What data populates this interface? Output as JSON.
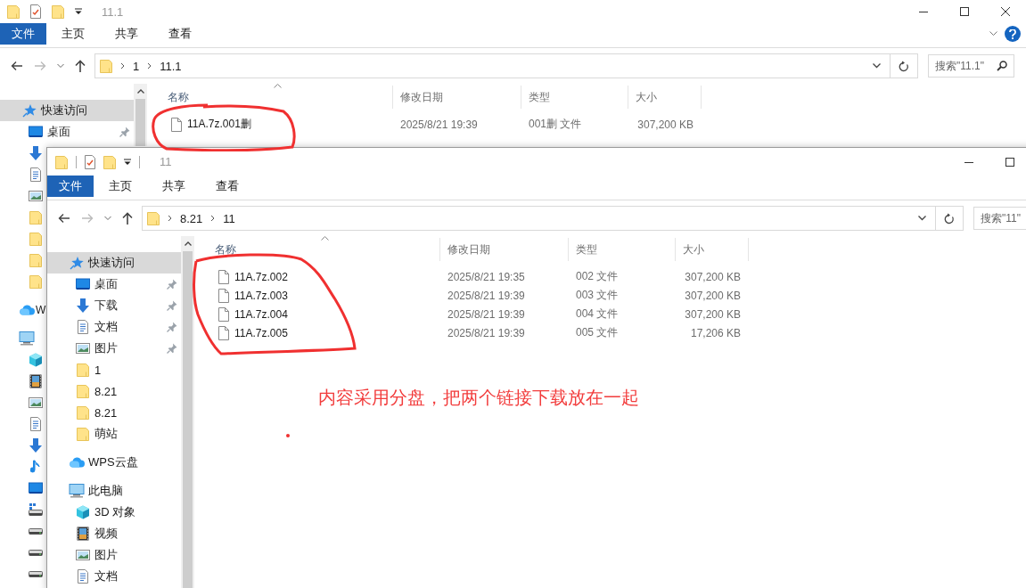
{
  "windows": [
    {
      "title": "11.1",
      "help_button": true,
      "ribbon_tabs": [
        {
          "label": "文件",
          "kind": "menu"
        },
        {
          "label": "主页",
          "kind": "tab"
        },
        {
          "label": "共享",
          "kind": "tab"
        },
        {
          "label": "查看",
          "kind": "tab"
        }
      ],
      "address": [
        "1",
        "11.1"
      ],
      "search": {
        "placeholder": "搜索\"11.1\""
      },
      "nav": [
        {
          "kind": "star",
          "label": "快速访问",
          "selected": true,
          "children": [
            {
              "kind": "desktop",
              "label": "桌面",
              "selected": false,
              "pinned": true
            },
            {
              "kind": "download",
              "selected": false
            },
            {
              "kind": "doc",
              "selected": false
            },
            {
              "kind": "picture",
              "selected": false
            },
            {
              "kind": "folder",
              "selected": false
            },
            {
              "kind": "folder",
              "selected": false
            },
            {
              "kind": "folder",
              "selected": false
            },
            {
              "kind": "folder",
              "selected": false
            }
          ]
        },
        {
          "kind": "cloud",
          "label": "W",
          "selected": false
        },
        {
          "kind": "pc",
          "selected": false,
          "children": [
            {
              "kind": "cube",
              "selected": false
            },
            {
              "kind": "video",
              "selected": false
            },
            {
              "kind": "picture",
              "selected": false
            },
            {
              "kind": "doc",
              "selected": false
            },
            {
              "kind": "download",
              "selected": false
            },
            {
              "kind": "music",
              "selected": false
            },
            {
              "kind": "desktop",
              "selected": false
            },
            {
              "kind": "netdrive",
              "selected": false
            },
            {
              "kind": "drive",
              "selected": false
            },
            {
              "kind": "drive",
              "selected": false
            },
            {
              "kind": "drive",
              "selected": false
            }
          ]
        }
      ],
      "columns": [
        "名称",
        "修改日期",
        "类型",
        "大小"
      ],
      "rows": [
        {
          "name": "11A.7z.001删",
          "modified": "2025/8/21 19:39",
          "type": "001删 文件",
          "size": "307,200 KB"
        }
      ]
    },
    {
      "title": "11",
      "ribbon_tabs": [
        {
          "label": "文件",
          "kind": "menu"
        },
        {
          "label": "主页",
          "kind": "tab"
        },
        {
          "label": "共享",
          "kind": "tab"
        },
        {
          "label": "查看",
          "kind": "tab"
        }
      ],
      "address": [
        "8.21",
        "11"
      ],
      "search": {
        "placeholder": "搜索\"11\""
      },
      "nav": [
        {
          "kind": "star",
          "label": "快速访问",
          "selected": true,
          "children": [
            {
              "kind": "desktop",
              "label": "桌面",
              "selected": false,
              "pinned": true
            },
            {
              "kind": "download",
              "label": "下载",
              "selected": false,
              "pinned": true
            },
            {
              "kind": "doc",
              "label": "文档",
              "selected": false,
              "pinned": true
            },
            {
              "kind": "picture",
              "label": "图片",
              "selected": false,
              "pinned": true
            },
            {
              "kind": "folder",
              "label": "1",
              "selected": false,
              "pinned": false
            },
            {
              "kind": "folder",
              "label": "8.21",
              "selected": false,
              "pinned": false
            },
            {
              "kind": "folder",
              "label": "8.21",
              "selected": false,
              "pinned": false
            },
            {
              "kind": "folder",
              "label": "萌站",
              "selected": false,
              "pinned": false
            }
          ]
        },
        {
          "kind": "cloud",
          "label": "WPS云盘",
          "selected": false
        },
        {
          "kind": "pc",
          "label": "此电脑",
          "selected": false,
          "children": [
            {
              "kind": "cube",
              "label": "3D 对象",
              "selected": false
            },
            {
              "kind": "video",
              "label": "视频",
              "selected": false
            },
            {
              "kind": "picture",
              "label": "图片",
              "selected": false
            },
            {
              "kind": "doc",
              "label": "文档",
              "selected": false
            }
          ]
        }
      ],
      "columns": [
        "名称",
        "修改日期",
        "类型",
        "大小"
      ],
      "rows": [
        {
          "name": "11A.7z.002",
          "modified": "2025/8/21 19:35",
          "type": "002 文件",
          "size": "307,200 KB"
        },
        {
          "name": "11A.7z.003",
          "modified": "2025/8/21 19:39",
          "type": "003 文件",
          "size": "307,200 KB"
        },
        {
          "name": "11A.7z.004",
          "modified": "2025/8/21 19:39",
          "type": "004 文件",
          "size": "307,200 KB"
        },
        {
          "name": "11A.7z.005",
          "modified": "2025/8/21 19:39",
          "type": "005 文件",
          "size": "17,206 KB"
        }
      ]
    }
  ],
  "annotation": {
    "text": "内容采用分盘，把两个链接下载放在一起"
  }
}
